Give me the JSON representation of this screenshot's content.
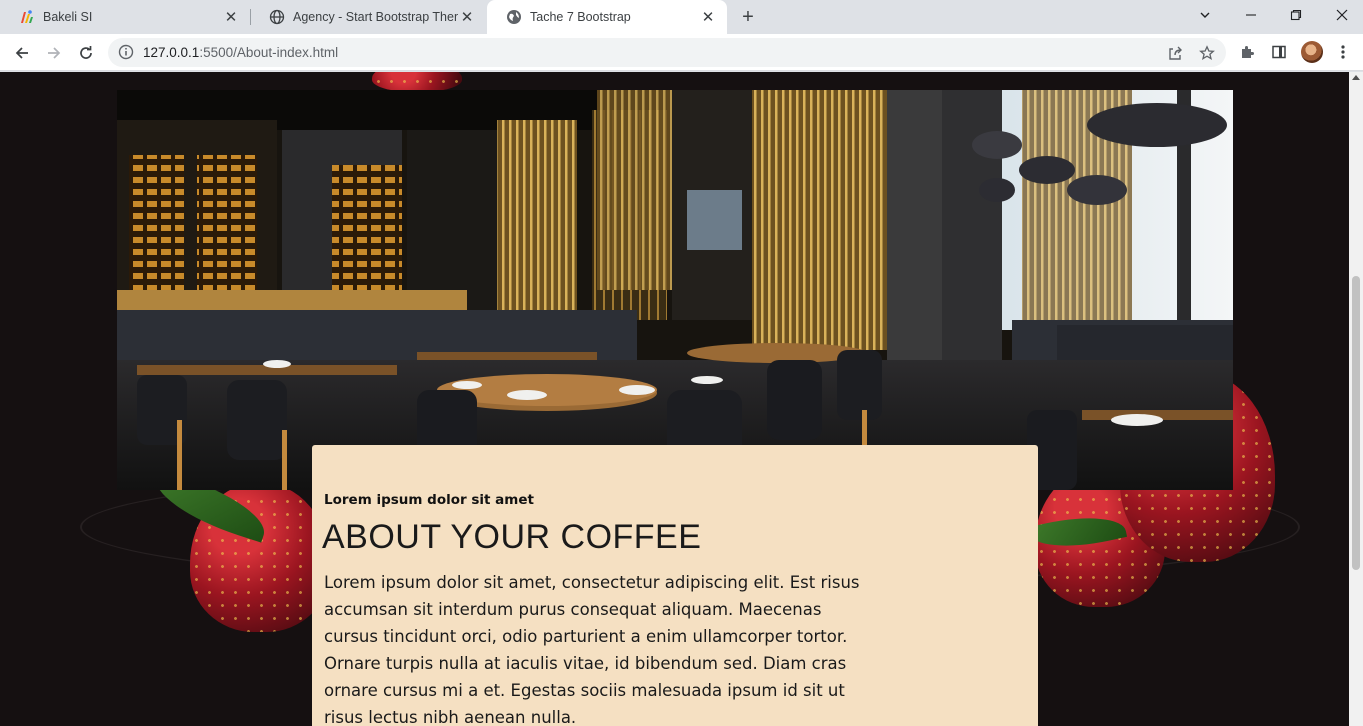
{
  "browser": {
    "tabs": [
      {
        "title": "Bakeli SI",
        "icon": "bakeli-logo-icon",
        "active": false
      },
      {
        "title": "Agency - Start Bootstrap Theme",
        "icon": "globe-icon",
        "active": false
      },
      {
        "title": "Tache 7 Bootstrap",
        "icon": "globe-icon",
        "active": true
      }
    ],
    "address": {
      "host": "127.0.0.1",
      "path": ":5500/About-index.html"
    }
  },
  "page": {
    "card": {
      "subtitle": "Lorem ipsum dolor sit amet",
      "heading": "ABOUT YOUR COFFEE",
      "body": "Lorem ipsum dolor sit amet, consectetur adipiscing elit. Est risus accumsan sit interdum purus consequat aliquam. Maecenas cursus tincidunt orci, odio parturient a enim ullamcorper tortor. Ornare turpis nulla at iaculis vitae, id bibendum sed. Diam cras ornare cursus mi a et. Egestas sociis malesuada ipsum id sit ut risus lectus nibh aenean nulla."
    },
    "colors": {
      "page_background": "#151011",
      "card_background": "#f5e0c2"
    }
  }
}
